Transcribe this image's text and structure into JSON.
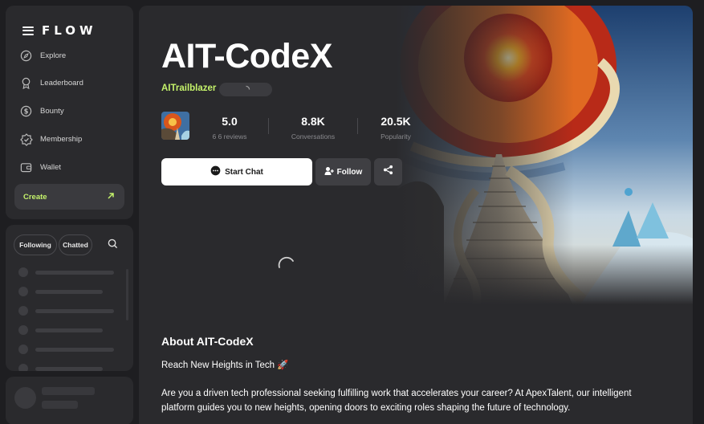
{
  "app": {
    "logo": "FLOW"
  },
  "sidebar": {
    "items": [
      {
        "label": "Explore",
        "icon": "compass-icon"
      },
      {
        "label": "Leaderboard",
        "icon": "medal-icon"
      },
      {
        "label": "Bounty",
        "icon": "dollar-coin-icon"
      },
      {
        "label": "Membership",
        "icon": "badge-check-icon"
      },
      {
        "label": "Wallet",
        "icon": "wallet-icon"
      }
    ],
    "create_label": "Create"
  },
  "recent": {
    "tabs": [
      "Following",
      "Chatted"
    ]
  },
  "bot": {
    "name": "AIT-CodeX",
    "author": "AITrailblazer",
    "stats": [
      {
        "value": "5.0",
        "label": "6 6 reviews"
      },
      {
        "value": "8.8K",
        "label": "Conversations"
      },
      {
        "value": "20.5K",
        "label": "Popularity"
      }
    ]
  },
  "actions": {
    "start_chat": "Start Chat",
    "follow": "Follow"
  },
  "about": {
    "heading": "About AIT-CodeX",
    "tagline": "Reach New Heights in Tech 🚀",
    "description": "Are you a driven tech professional seeking fulfilling work that accelerates your career? At ApexTalent, our intelligent platform guides you to new heights, opening doors to exciting roles shaping the future of technology."
  },
  "colors": {
    "accent": "#c5f36b",
    "panel": "#2a2a2d",
    "background": "#1e1e21"
  }
}
